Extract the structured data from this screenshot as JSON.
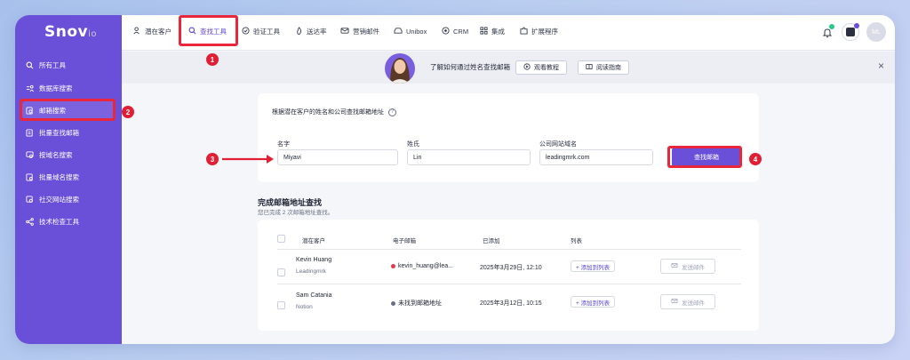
{
  "logo": {
    "main": "Snov",
    "sub": "io"
  },
  "sidebar": {
    "items": [
      {
        "label": "所有工具"
      },
      {
        "label": "数据库搜索"
      },
      {
        "label": "邮箱搜索"
      },
      {
        "label": "批量查找邮箱"
      },
      {
        "label": "按域名搜索"
      },
      {
        "label": "批量域名搜索"
      },
      {
        "label": "社交网站搜索"
      },
      {
        "label": "技术检查工具"
      }
    ]
  },
  "nav": {
    "items": [
      {
        "label": "潜在客户"
      },
      {
        "label": "查找工具"
      },
      {
        "label": "验证工具"
      },
      {
        "label": "送达率"
      },
      {
        "label": "营销邮件"
      },
      {
        "label": "Unibox"
      },
      {
        "label": "CRM"
      },
      {
        "label": "集成"
      },
      {
        "label": "扩展程序"
      }
    ],
    "avatar": "ML"
  },
  "banner": {
    "text": "了解如何通过姓名查找邮箱",
    "watch_label": "观看教程",
    "guide_label": "阅读指南",
    "close": "×"
  },
  "search_form": {
    "title": "根据潜在客户的姓名和公司查找邮箱地址",
    "first_name_label": "名字",
    "first_name_value": "Miyavi",
    "last_name_label": "姓氏",
    "last_name_value": "Lin",
    "domain_label": "公司网站域名",
    "domain_value": "leadingmrk.com",
    "submit_label": "查找邮箱"
  },
  "results": {
    "title": "完成邮箱地址查找",
    "subtitle": "您已完成 2 次邮箱地址查找。",
    "headers": [
      "潜在客户",
      "电子邮箱",
      "已添加",
      "列表"
    ],
    "rows": [
      {
        "name": "Kevin Huang",
        "company": "Leadingmrk",
        "email": "kevin_huang@lea...",
        "email_status_color": "#e5394d",
        "added": "2025年3月29日, 12:10",
        "list_label": "+ 添加到列表",
        "send_label": "发送邮件"
      },
      {
        "name": "Sam Catania",
        "company": "Notion",
        "email": "未找到邮箱地址",
        "email_status_color": "#6b7086",
        "added": "2025年3月12日, 10:15",
        "list_label": "+ 添加到列表",
        "send_label": "发送邮件"
      }
    ]
  },
  "callouts": [
    "1",
    "2",
    "3",
    "4"
  ],
  "colors": {
    "accent": "#6a50d8",
    "highlight": "#e8273d"
  }
}
